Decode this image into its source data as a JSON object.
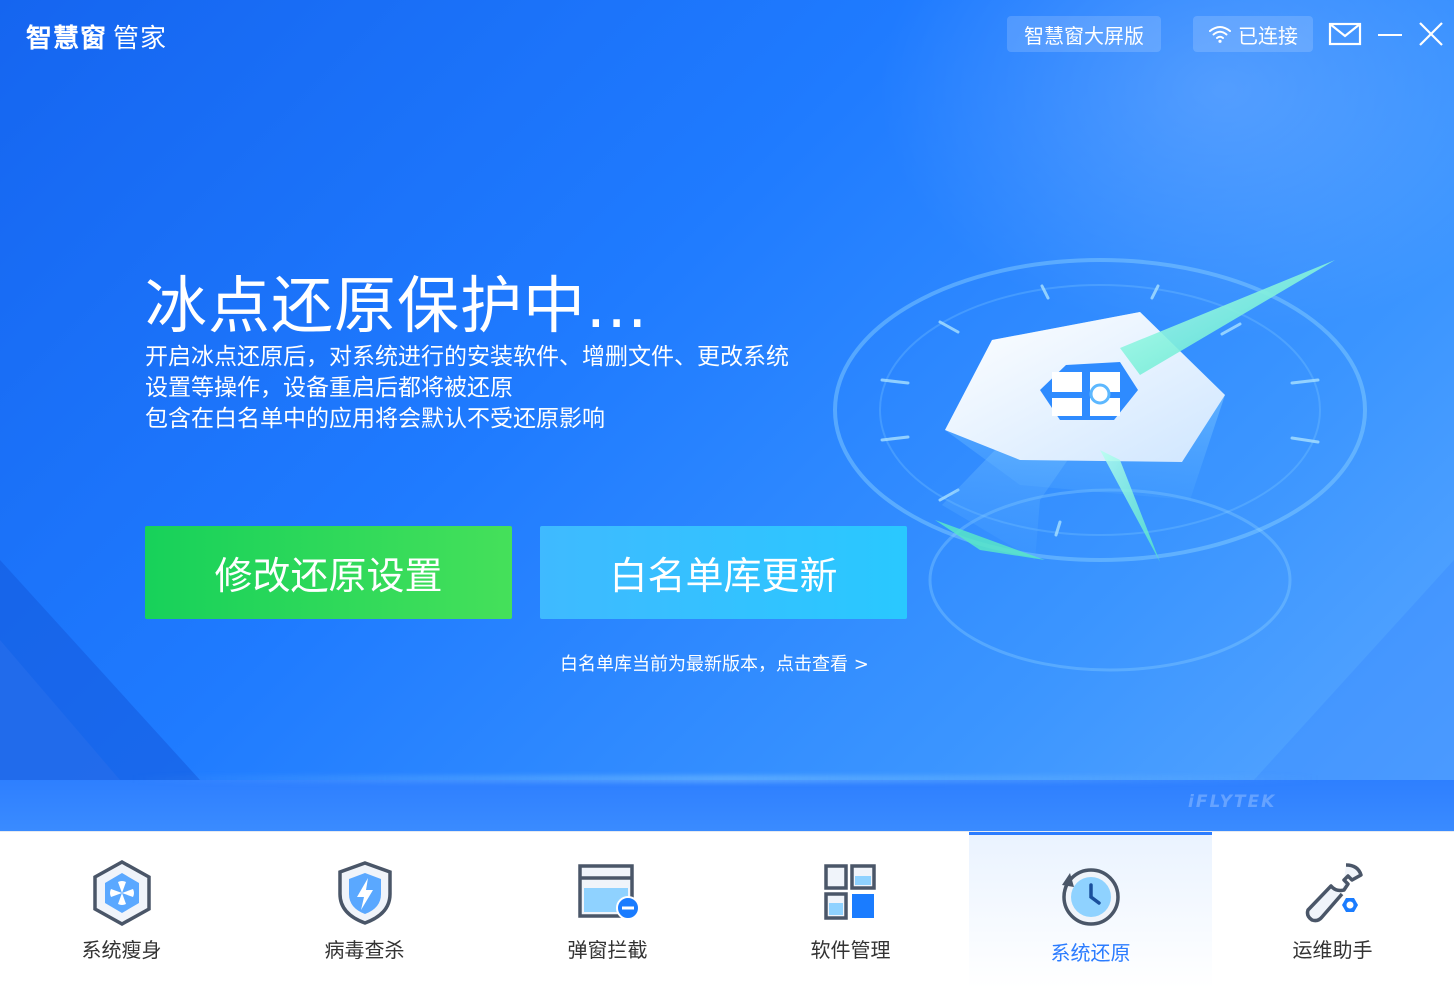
{
  "app": {
    "brand_main": "智慧窗",
    "brand_sub": "管家"
  },
  "header": {
    "bigscreen_label": "智慧窗大屏版",
    "wifi_label": "已连接"
  },
  "main": {
    "headline": "冰点还原保护中...",
    "description": [
      "开启冰点还原后，对系统进行的安装软件、增删文件、更改系统",
      "设置等操作，设备重启后都将被还原",
      "包含在白名单中的应用将会默认不受还原影响"
    ],
    "modify_button": "修改还原设置",
    "whitelist_button": "白名单库更新",
    "hint": "白名单库当前为最新版本，点击查看 >",
    "watermark": "iFLYTEK"
  },
  "tabs": [
    {
      "label": "系统瘦身",
      "icon": "slim-icon",
      "active": false
    },
    {
      "label": "病毒查杀",
      "icon": "shield-bolt-icon",
      "active": false
    },
    {
      "label": "弹窗拦截",
      "icon": "popup-block-icon",
      "active": false
    },
    {
      "label": "软件管理",
      "icon": "apps-grid-icon",
      "active": false
    },
    {
      "label": "系统还原",
      "icon": "restore-clock-icon",
      "active": true
    },
    {
      "label": "运维助手",
      "icon": "wrench-icon",
      "active": false
    }
  ],
  "colors": {
    "accent": "#2b7cff",
    "green_button": "#22d55a",
    "cyan_button": "#33c2ff"
  }
}
